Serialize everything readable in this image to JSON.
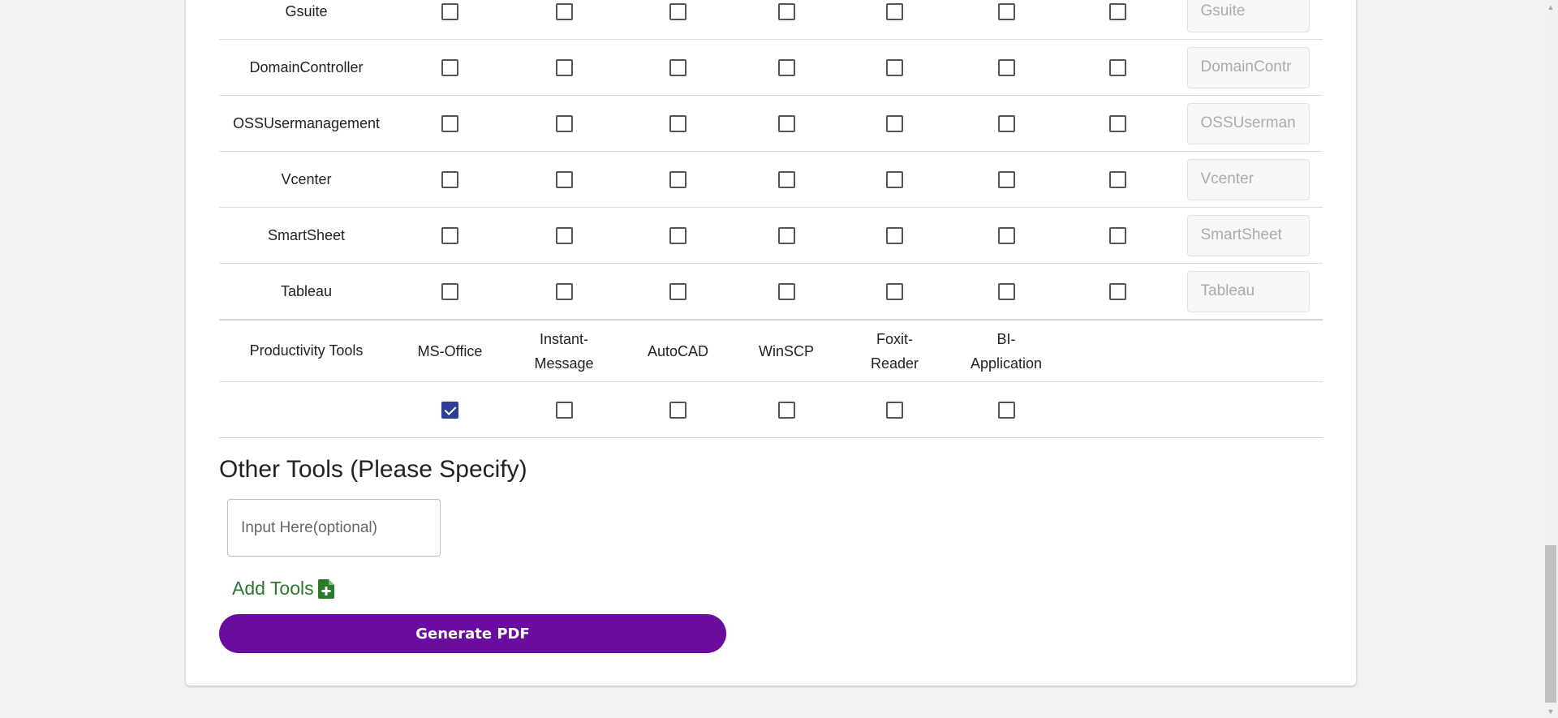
{
  "tools": [
    {
      "name": "Gsuite",
      "checks": [
        false,
        false,
        false,
        false,
        false,
        false,
        false
      ],
      "placeholder": "Gsuite"
    },
    {
      "name": "DomainController",
      "checks": [
        false,
        false,
        false,
        false,
        false,
        false,
        false
      ],
      "placeholder": "DomainContr"
    },
    {
      "name": "OSSUsermanagement",
      "checks": [
        false,
        false,
        false,
        false,
        false,
        false,
        false
      ],
      "placeholder": "OSSUserman"
    },
    {
      "name": "Vcenter",
      "checks": [
        false,
        false,
        false,
        false,
        false,
        false,
        false
      ],
      "placeholder": "Vcenter"
    },
    {
      "name": "SmartSheet",
      "checks": [
        false,
        false,
        false,
        false,
        false,
        false,
        false
      ],
      "placeholder": "SmartSheet"
    },
    {
      "name": "Tableau",
      "checks": [
        false,
        false,
        false,
        false,
        false,
        false,
        false
      ],
      "placeholder": "Tableau"
    }
  ],
  "productivity": {
    "label": "Productivity Tools",
    "columns": [
      "MS-Office",
      "Instant-\nMessage",
      "AutoCAD",
      "WinSCP",
      "Foxit-\nReader",
      "BI-\nApplication"
    ],
    "checks": [
      true,
      false,
      false,
      false,
      false,
      false
    ]
  },
  "other_tools": {
    "title": "Other Tools (Please Specify)",
    "placeholder": "Input Here(optional)"
  },
  "add_tools": {
    "label": "Add Tools",
    "icon": "file-plus-icon",
    "color": "#2a7a2a"
  },
  "generate_button": {
    "label": "Generate PDF",
    "color": "#6a0d9e"
  },
  "colors": {
    "checkbox_checked": "#2e3d98"
  }
}
